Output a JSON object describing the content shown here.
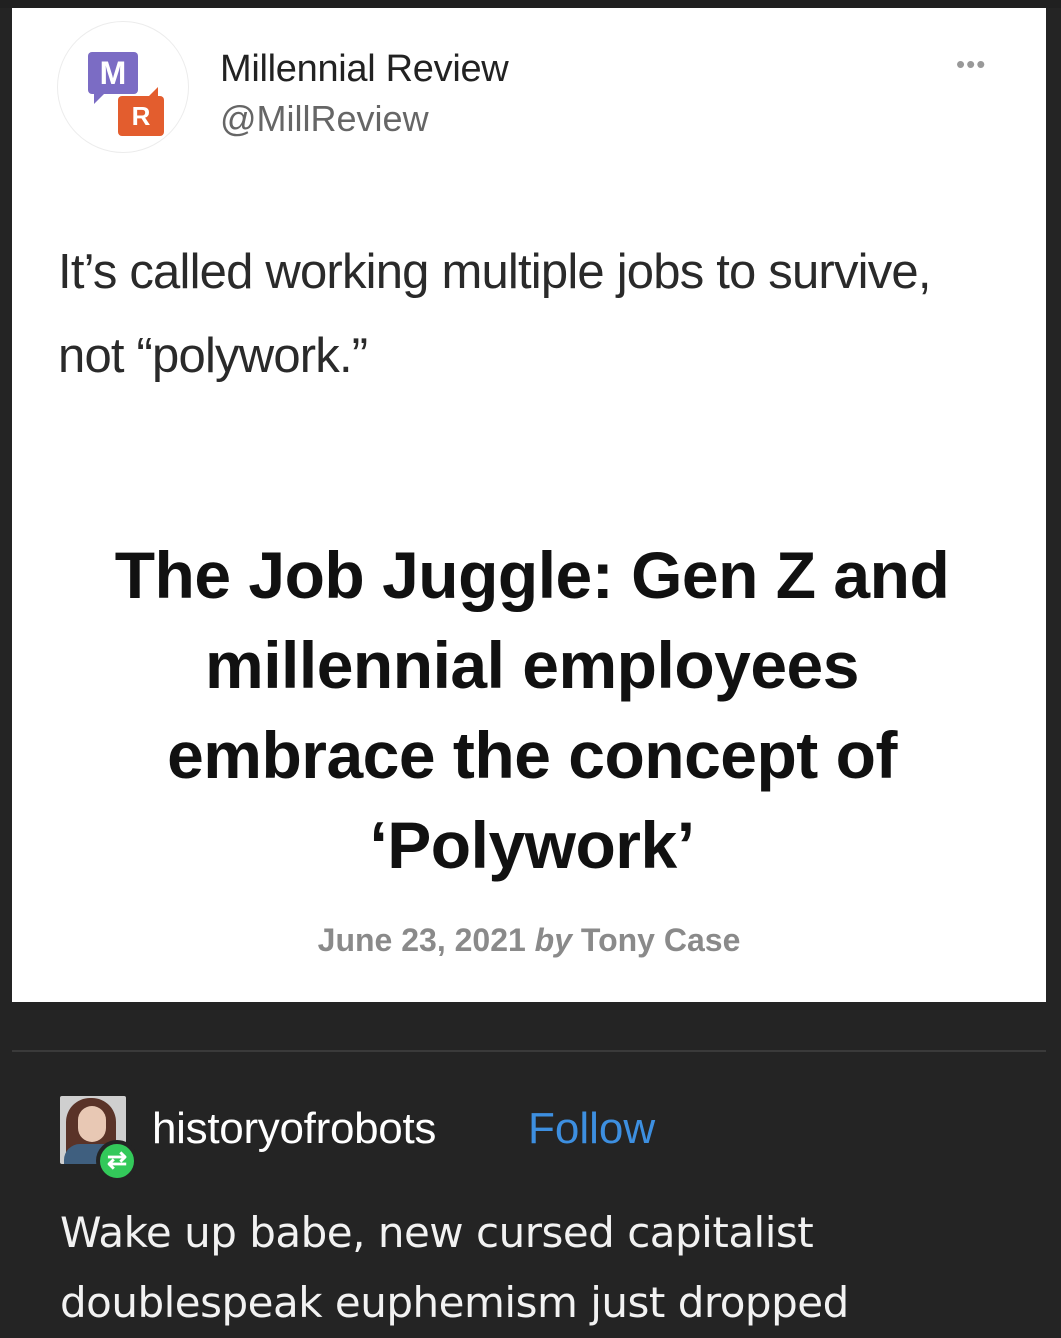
{
  "tweet": {
    "account_name": "Millennial Review",
    "handle": "@MillReview",
    "logo_letter_1": "M",
    "logo_letter_2": "R",
    "more_icon": "•••",
    "body": "It’s called working multiple jobs to survive, not “polywork.”",
    "article": {
      "headline": "The Job Juggle: Gen Z and millennial employees embrace the concept of ‘Polywork’",
      "date": "June 23, 2021",
      "by": "by",
      "author": "Tony Case"
    },
    "colors": {
      "logo_m": "#7b6cc4",
      "logo_r": "#e35d2e"
    }
  },
  "reblog": {
    "username": "historyofrobots",
    "follow_label": "Follow",
    "reblog_icon": "⇄",
    "comment": "Wake up babe, new cursed capitalist doublespeak euphemism just dropped",
    "colors": {
      "follow": "#3d8fe0",
      "reblog_badge": "#33c95a",
      "background": "#242424"
    }
  }
}
